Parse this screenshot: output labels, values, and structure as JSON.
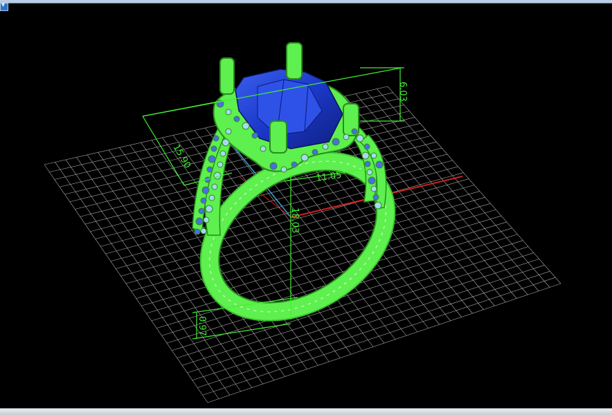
{
  "toolbar": {
    "menu_icon": "chevron-down-icon",
    "menu_glyph": "▾"
  },
  "viewport": {
    "background": "#000000",
    "grid_color": "#d8d8d8",
    "model_color": "#5ef04e",
    "gem_color": "#1e3fd0",
    "pave_stone_color": "#a8d8f0",
    "axis_x_color": "#d22020",
    "axis_y_color": "#3aa0d8",
    "dimension_color": "#42f032"
  },
  "dimensions": {
    "gem_height": "6.03",
    "band_depth": "15.90",
    "inner_width": "11.05",
    "total_height": "18.03",
    "band_thickness": "0.97"
  }
}
